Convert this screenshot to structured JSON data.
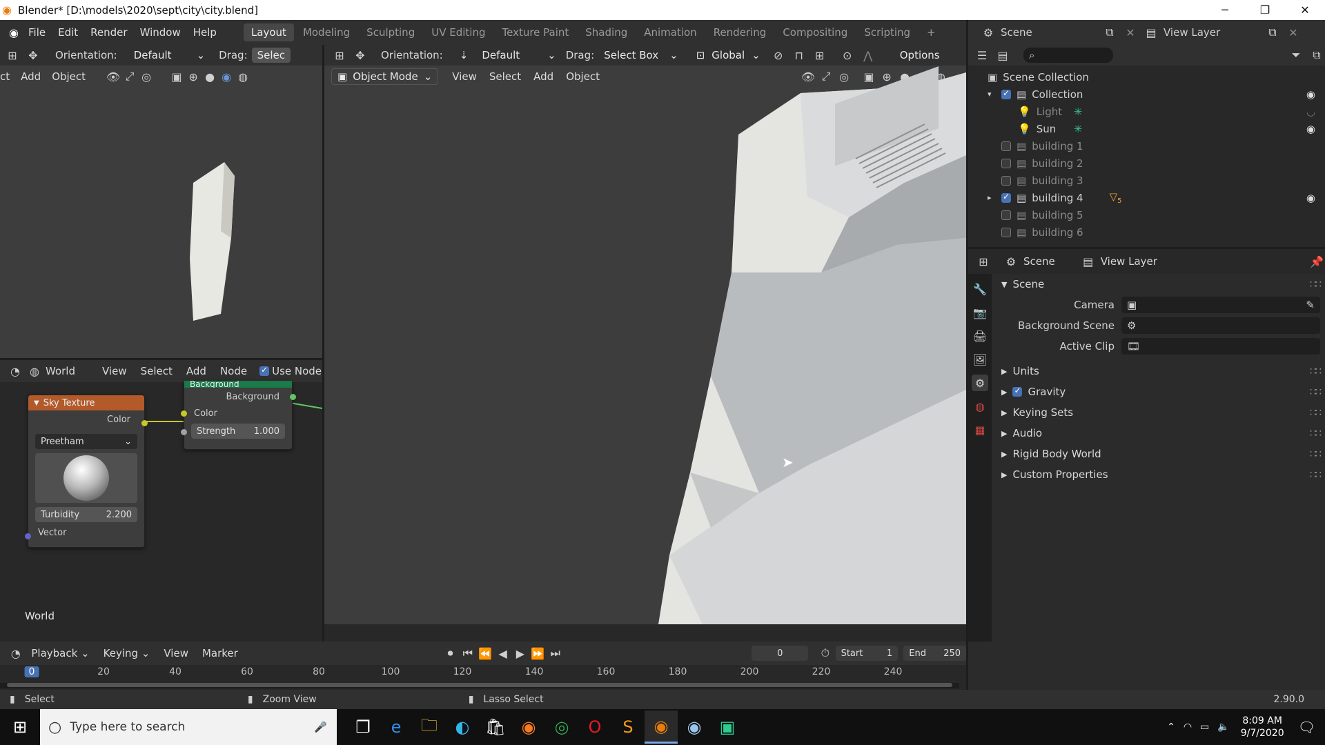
{
  "window": {
    "title": "Blender* [D:\\models\\2020\\sept\\city\\city.blend]",
    "controls": [
      "─",
      "❐",
      "✕"
    ]
  },
  "menu": [
    "File",
    "Edit",
    "Render",
    "Window",
    "Help"
  ],
  "workspaces": [
    "Layout",
    "Modeling",
    "Sculpting",
    "UV Editing",
    "Texture Paint",
    "Shading",
    "Animation",
    "Rendering",
    "Compositing",
    "Scripting"
  ],
  "active_workspace": "Layout",
  "top_right": {
    "scene": "Scene",
    "view_layer": "View Layer"
  },
  "left_view": {
    "orientation_label": "Orientation:",
    "orientation": "Default",
    "drag_label": "Drag:",
    "drag": "Selec",
    "menus": [
      "ct",
      "Add",
      "Object"
    ]
  },
  "main_view": {
    "orientation_label": "Orientation:",
    "orientation": "Default",
    "drag_label": "Drag:",
    "drag": "Select Box",
    "transform": "Global",
    "options": "Options",
    "mode": "Object Mode",
    "menus": [
      "View",
      "Select",
      "Add",
      "Object"
    ]
  },
  "node_editor": {
    "type": "World",
    "menus": [
      "View",
      "Select",
      "Add",
      "Node"
    ],
    "use_nodes": "Use Node",
    "label": "World",
    "sky": {
      "title": "Sky Texture",
      "out": "Color",
      "mode": "Preetham",
      "turb_label": "Turbidity",
      "turb_value": "2.200",
      "vector": "Vector"
    },
    "bg": {
      "title": "Background",
      "out": "Background",
      "color": "Color",
      "strength_label": "Strength",
      "strength_value": "1.000"
    }
  },
  "outliner": {
    "root": "Scene Collection",
    "items": [
      {
        "name": "Collection",
        "level": 1,
        "checked": true,
        "expand": "▾",
        "visible": true
      },
      {
        "name": "Light",
        "level": 2,
        "dim": true,
        "visible": false
      },
      {
        "name": "Sun",
        "level": 2,
        "visible": true
      },
      {
        "name": "building 1",
        "level": 1,
        "checked": false,
        "dim": true
      },
      {
        "name": "building 2",
        "level": 1,
        "checked": false,
        "dim": true
      },
      {
        "name": "building 3",
        "level": 1,
        "checked": false,
        "dim": true
      },
      {
        "name": "building 4",
        "level": 1,
        "checked": true,
        "expand": "▸",
        "badge": "5",
        "visible": true
      },
      {
        "name": "building 5",
        "level": 1,
        "checked": false,
        "dim": true
      },
      {
        "name": "building 6",
        "level": 1,
        "checked": false,
        "dim": true
      }
    ]
  },
  "properties": {
    "crumb_scene": "Scene",
    "crumb_view_layer": "View Layer",
    "section": "Scene",
    "fields": [
      {
        "label": "Camera"
      },
      {
        "label": "Background Scene"
      },
      {
        "label": "Active Clip"
      }
    ],
    "subsections": [
      {
        "label": "Units",
        "checkbox": false
      },
      {
        "label": "Gravity",
        "checkbox": true
      },
      {
        "label": "Keying Sets",
        "checkbox": false
      },
      {
        "label": "Audio",
        "checkbox": false
      },
      {
        "label": "Rigid Body World",
        "checkbox": false
      },
      {
        "label": "Custom Properties",
        "checkbox": false
      }
    ]
  },
  "timeline": {
    "menus": [
      "Playback",
      "Keying",
      "View",
      "Marker"
    ],
    "current_frame": "0",
    "start_label": "Start",
    "start": "1",
    "end_label": "End",
    "end": "250",
    "ticks": [
      "0",
      "20",
      "40",
      "60",
      "80",
      "100",
      "120",
      "140",
      "160",
      "180",
      "200",
      "220",
      "240"
    ]
  },
  "statusbar": {
    "select": "Select",
    "zoom": "Zoom View",
    "lasso": "Lasso Select",
    "version": "2.90.0"
  },
  "taskbar": {
    "search_placeholder": "Type here to search",
    "time": "8:09 AM",
    "date": "9/7/2020"
  }
}
